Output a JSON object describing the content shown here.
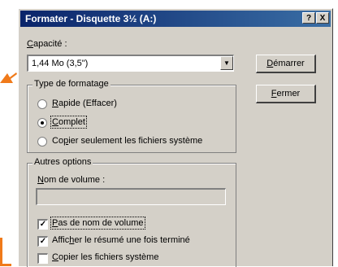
{
  "window": {
    "title": "Formater - Disquette 3½ (A:)",
    "help_button": "?",
    "close_button": "X"
  },
  "capacity": {
    "label_u": "C",
    "label_rest": "apacité :",
    "value": "1,44 Mo (3,5\")"
  },
  "buttons": {
    "start_pre": "",
    "start_u": "D",
    "start_rest": "émarrer",
    "close_u": "F",
    "close_rest": "ermer"
  },
  "format_type": {
    "title": "Type de formatage",
    "options": [
      {
        "pre": "",
        "u": "R",
        "rest": "apide (Effacer)",
        "selected": false
      },
      {
        "pre": "",
        "u": "C",
        "rest": "omplet",
        "selected": true
      },
      {
        "pre": "Co",
        "u": "p",
        "rest": "ier seulement les fichiers système",
        "selected": false
      }
    ]
  },
  "other_options": {
    "title": "Autres options",
    "volume_label_pre": "",
    "volume_label_u": "N",
    "volume_label_rest": "om de volume :",
    "volume_value": "",
    "checkboxes": [
      {
        "pre": "",
        "u": "P",
        "rest": "as de nom de volume",
        "checked": true
      },
      {
        "pre": "Affic",
        "u": "h",
        "rest": "er le résumé une fois terminé",
        "checked": true
      },
      {
        "pre": "",
        "u": "C",
        "rest": "opier les fichiers système",
        "checked": false
      }
    ]
  },
  "accent_color": "#f07a1a"
}
